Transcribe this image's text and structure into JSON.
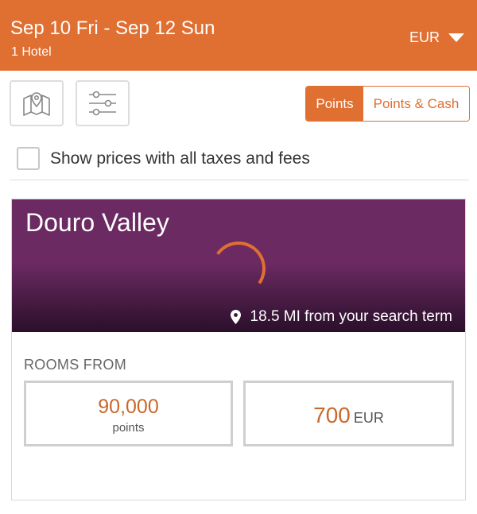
{
  "header": {
    "dates": "Sep 10 Fri - Sep 12 Sun",
    "hotel_count": "1 Hotel",
    "currency": "EUR",
    "background_color": "#e06f32"
  },
  "toolbar": {
    "map_icon": "map-pin-icon",
    "filter_icon": "sliders-icon",
    "pricing_toggle": {
      "options": [
        "Points",
        "Points & Cash"
      ],
      "selected": "Points"
    }
  },
  "tax_option": {
    "label": "Show prices with all taxes and fees",
    "checked": false
  },
  "hotel": {
    "name": "Douro Valley",
    "distance": "18.5 MI from your search term",
    "rooms_from_label": "ROOMS FROM",
    "points_price": "90,000",
    "points_unit": "points",
    "cash_price": "700",
    "cash_currency": "EUR"
  },
  "colors": {
    "accent": "#e06f32",
    "hero_purple": "#6b2a62"
  }
}
